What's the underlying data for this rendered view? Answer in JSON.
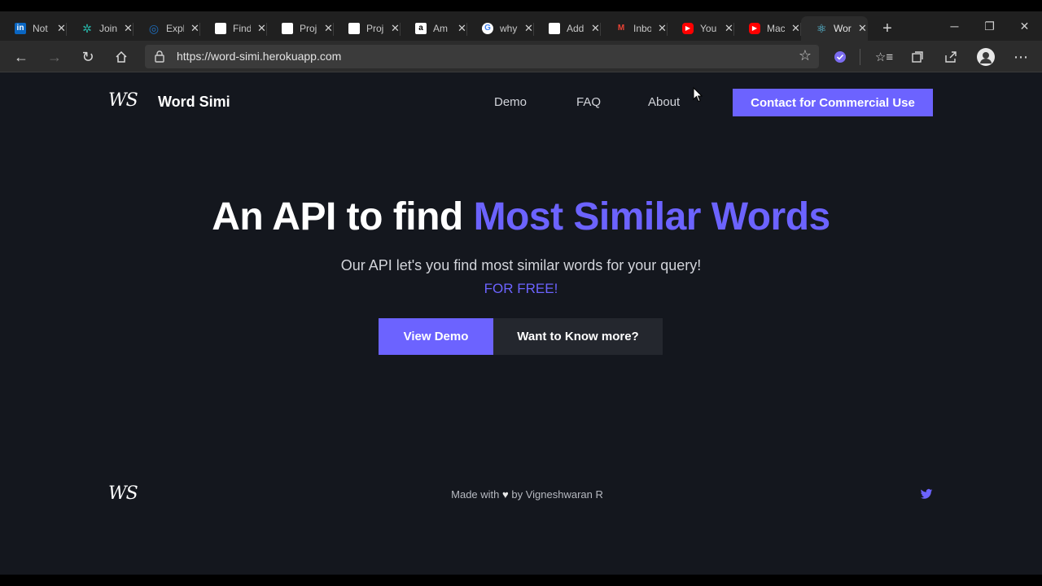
{
  "browser": {
    "tabs": [
      {
        "title": "Not",
        "icon": "linkedin-icon",
        "color": "#0a66c2",
        "glyph": "in"
      },
      {
        "title": "Join",
        "icon": "gear-icon",
        "color": "#27b3a6",
        "glyph": "✲"
      },
      {
        "title": "Expl",
        "icon": "globe-icon",
        "color": "#1f6fbf",
        "glyph": "◎"
      },
      {
        "title": "Find",
        "icon": "cisco-icon",
        "color": "#ffffff",
        "glyph": ""
      },
      {
        "title": "Proj",
        "icon": "cisco-icon",
        "color": "#ffffff",
        "glyph": ""
      },
      {
        "title": "Proj",
        "icon": "cisco-icon",
        "color": "#ffffff",
        "glyph": ""
      },
      {
        "title": "Am",
        "icon": "amazon-icon",
        "color": "#ffffff",
        "glyph": "a"
      },
      {
        "title": "why",
        "icon": "google-icon",
        "color": "#ffffff",
        "glyph": "G"
      },
      {
        "title": "Add",
        "icon": "blank-page-icon",
        "color": "#ffffff",
        "glyph": ""
      },
      {
        "title": "Inbo",
        "icon": "gmail-icon",
        "color": "#ea4335",
        "glyph": "M"
      },
      {
        "title": "You",
        "icon": "youtube-icon",
        "color": "#ff0000",
        "glyph": "▶"
      },
      {
        "title": "Mac",
        "icon": "youtube-icon",
        "color": "#ff0000",
        "glyph": "▶"
      },
      {
        "title": "Wor",
        "icon": "react-icon",
        "color": "#61dafb",
        "glyph": "⚛"
      }
    ],
    "url": "https://word-simi.herokuapp.com"
  },
  "site": {
    "logo": "WS",
    "brand": "Word Simi",
    "nav": {
      "demo": "Demo",
      "faq": "FAQ",
      "about": "About"
    },
    "cta": "Contact for Commercial Use",
    "accent_color": "#6c63ff"
  },
  "hero": {
    "title_main": "An API to find ",
    "title_accent": "Most Similar Words",
    "subtitle": "Our API let's you find most similar words for your query!",
    "free": "FOR FREE!",
    "btn_demo": "View Demo",
    "btn_more": "Want to Know more?"
  },
  "footer": {
    "logo": "WS",
    "made_with": "Made with",
    "by": "by Vigneshwaran R",
    "twitter_icon": "twitter-icon"
  }
}
